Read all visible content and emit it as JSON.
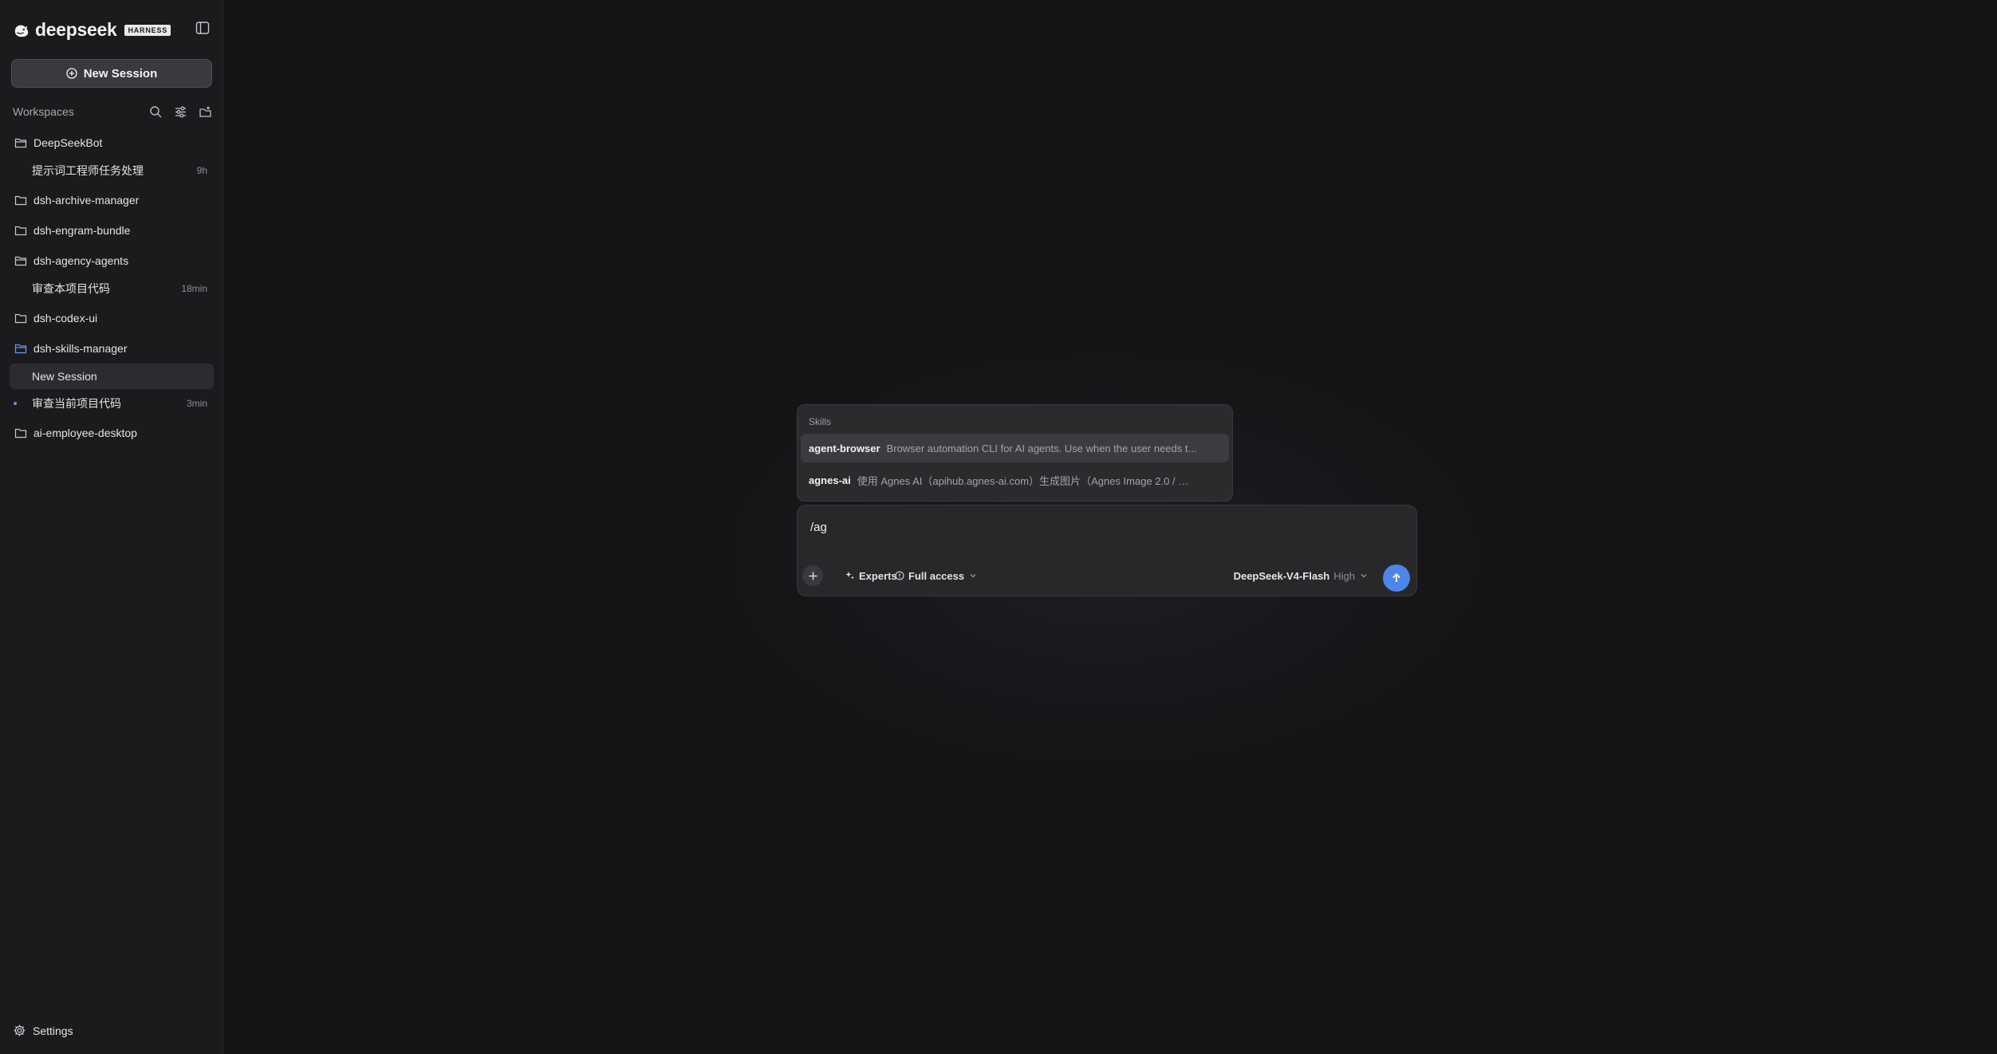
{
  "brand": {
    "name": "deepseek",
    "badge": "HARNESS"
  },
  "sidebar": {
    "new_session_label": "New Session",
    "workspaces_label": "Workspaces",
    "settings_label": "Settings",
    "tree": [
      {
        "type": "workspace",
        "label": "DeepSeekBot",
        "open": true
      },
      {
        "type": "session",
        "label": "提示词工程师任务处理",
        "time": "9h"
      },
      {
        "type": "workspace",
        "label": "dsh-archive-manager"
      },
      {
        "type": "workspace",
        "label": "dsh-engram-bundle"
      },
      {
        "type": "workspace",
        "label": "dsh-agency-agents",
        "open": true
      },
      {
        "type": "session",
        "label": "审查本项目代码",
        "time": "18min"
      },
      {
        "type": "workspace",
        "label": "dsh-codex-ui"
      },
      {
        "type": "workspace",
        "label": "dsh-skills-manager",
        "open": true,
        "accent": true
      },
      {
        "type": "session",
        "label": "New Session",
        "active": true
      },
      {
        "type": "session",
        "label": "审查当前项目代码",
        "time": "3min",
        "running": true
      },
      {
        "type": "workspace",
        "label": "ai-employee-desktop"
      }
    ]
  },
  "skills_popup": {
    "title": "Skills",
    "items": [
      {
        "name": "agent-browser",
        "desc": "Browser automation CLI for AI agents. Use when the user needs t...",
        "highlighted": true
      },
      {
        "name": "agnes-ai",
        "desc": "使用 Agnes AI（apihub.agnes-ai.com）生成图片（Agnes Image 2.0 / 2...."
      }
    ]
  },
  "composer": {
    "value": "/ag",
    "experts_label": "Experts",
    "access_label": "Full access",
    "model_name": "DeepSeek-V4-Flash",
    "model_effort": "High"
  },
  "colors": {
    "accent": "#4d86e8",
    "sidebar_bg": "#1b1b1d",
    "main_bg": "#151517"
  }
}
